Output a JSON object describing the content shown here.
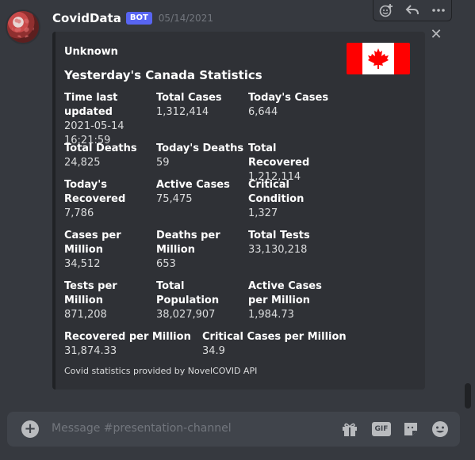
{
  "message": {
    "username": "CovidData",
    "bot_tag": "BOT",
    "timestamp": "05/14/2021"
  },
  "embed": {
    "author": "Unknown",
    "title": "Yesterday's Canada Statistics",
    "fields": [
      {
        "name": "Time last updated",
        "value": "2021-05-14 16:21:59"
      },
      {
        "name": "Total Cases",
        "value": "1,312,414"
      },
      {
        "name": "Today's Cases",
        "value": "6,644"
      },
      {
        "name": "Total Deaths",
        "value": "24,825"
      },
      {
        "name": "Today's Deaths",
        "value": "59"
      },
      {
        "name": "Total Recovered",
        "value": "1,212,114"
      },
      {
        "name": "Today's Recovered",
        "value": "7,786"
      },
      {
        "name": "Active Cases",
        "value": "75,475"
      },
      {
        "name": "Critical Condition",
        "value": "1,327"
      },
      {
        "name": "Cases per Million",
        "value": "34,512"
      },
      {
        "name": "Deaths per Million",
        "value": "653"
      },
      {
        "name": "Total Tests",
        "value": "33,130,218"
      },
      {
        "name": "Tests per Million",
        "value": "871,208"
      },
      {
        "name": "Total Population",
        "value": "38,027,907"
      },
      {
        "name": "Active Cases per Million",
        "value": "1,984.73"
      },
      {
        "name": "Recovered per Million",
        "value": "31,874.33"
      },
      {
        "name": "Critical Cases per Million",
        "value": "34.9"
      }
    ],
    "footer": "Covid statistics provided by NovelCOVID API"
  },
  "composer": {
    "placeholder": "Message #presentation-channel",
    "gif_label": "GIF"
  },
  "colors": {
    "background": "#36393f",
    "embed_background": "#2f3136",
    "bot_tag": "#5865f2",
    "flag_red": "#ff0000"
  },
  "icons": {
    "hover_toolbar": [
      "add-reaction-icon",
      "reply-icon",
      "more-options-icon"
    ],
    "composer": [
      "plus-icon",
      "gift-icon",
      "gif-icon",
      "sticker-icon",
      "emoji-icon"
    ],
    "embed": [
      "close-icon",
      "canada-flag-icon"
    ]
  }
}
